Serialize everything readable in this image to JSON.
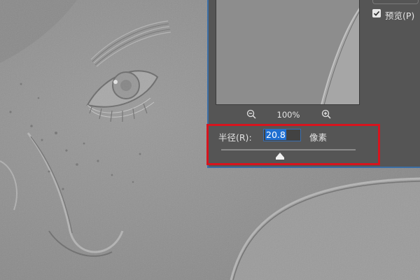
{
  "filter_dialog": {
    "zoom": {
      "zoom_out_icon": "zoom-out-icon",
      "zoom_in_icon": "zoom-in-icon",
      "value": "100%"
    },
    "radius": {
      "label": "半径(R):",
      "value": "20.8",
      "unit": "像素",
      "slider_position": 0.44
    },
    "preview_checkbox": {
      "label": "预览(P)",
      "checked": true
    }
  },
  "colors": {
    "dialog_bg": "#555555",
    "accent_blue": "#3b6ea5",
    "highlight_red": "#d7141e",
    "selection_blue": "#1f6fd1"
  }
}
